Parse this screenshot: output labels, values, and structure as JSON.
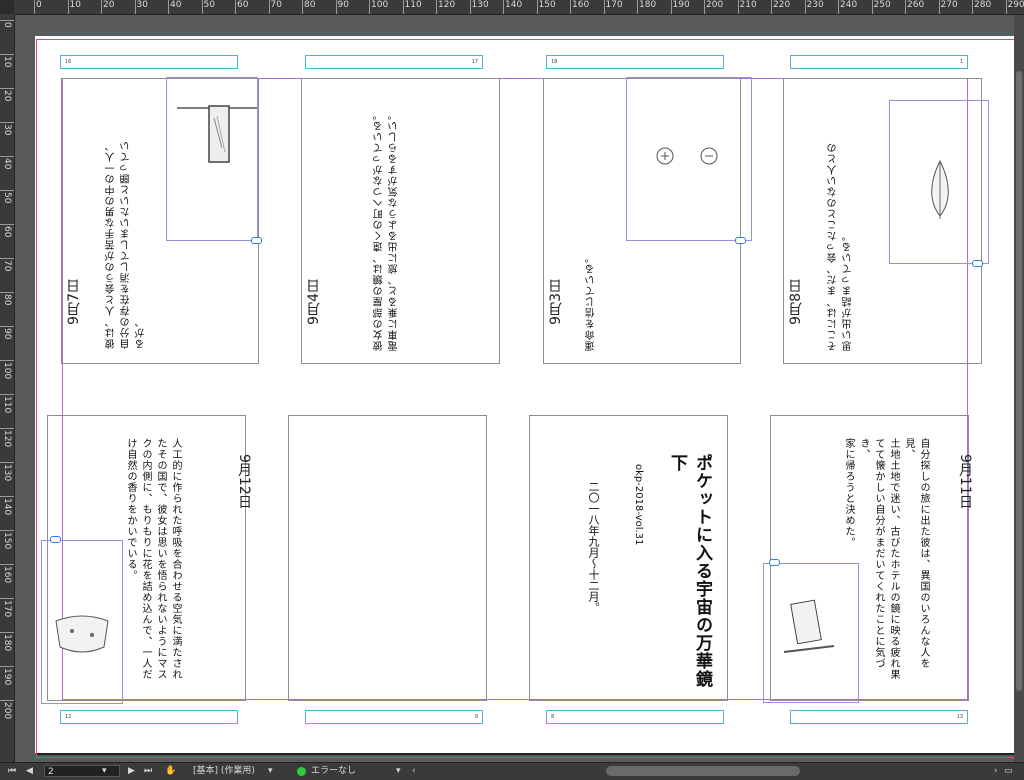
{
  "ruler": {
    "top_labels": [
      "0",
      "10",
      "20",
      "30",
      "40",
      "50",
      "60",
      "70",
      "80",
      "90",
      "100",
      "110",
      "120",
      "130",
      "140",
      "150",
      "160",
      "170",
      "180",
      "190",
      "200",
      "210",
      "220",
      "230",
      "240",
      "250",
      "260",
      "270",
      "280",
      "290"
    ],
    "left_labels": [
      "0",
      "10",
      "20",
      "30",
      "40",
      "50",
      "60",
      "70",
      "80",
      "90",
      "100",
      "110",
      "120",
      "130",
      "140",
      "150",
      "160",
      "170",
      "180",
      "190",
      "200"
    ]
  },
  "headers": {
    "top": [
      "16",
      "17",
      "18",
      "1"
    ],
    "bottom": [
      "12",
      "9",
      "8",
      "13"
    ]
  },
  "pages": {
    "p1_date": "9月7日",
    "p1_text": [
      "彼は、人と会うのが苦手な男の中の一人、",
      "自分の存在を消してしまいたいと願ってい",
      "るが、"
    ],
    "p2_date": "9月4日",
    "p2_text": [
      "彼女の部屋の鏡は、遠くの町へつながっている。",
      "電車に乗ると、旅に出るような気がするらしい。"
    ],
    "p3_date": "9月3日",
    "p3_text": [
      "運命を信じている。"
    ],
    "p4_date": "9月8日",
    "p4_text": [
      "そこには、まだ、会ったことのない人との",
      "思い出が詰まっている。"
    ],
    "p5_date": "9月12日",
    "p5_text": [
      "人工的に作られた呼吸を合わせる空気に満たされ",
      "たその国で、彼女は思いを悟られないようにマス",
      "クの内側に、もりもりに花を詰め込んで、一人だ",
      "け自然の香りをかいでいる。"
    ],
    "p6_date": "",
    "p7_title": "ポケットに入る宇宙の万華鏡 下",
    "p7_sub": "okp-2018-vol.31",
    "p7_date": "二〇一八年九月〜十二月。",
    "p8_date": "9月11日",
    "p8_text": [
      "自分探しの旅に出た彼は、異国のいろんな人を見、",
      "土地土地で迷い、古びたホテルの鏡に映る疲れ果",
      "てて懐かしい自分がまだいてくれたことに気づき、",
      "家に帰ろうと決めた。"
    ]
  },
  "status": {
    "page_value": "2",
    "master_label": "[基本] (作業用)",
    "error_label": "エラーなし"
  },
  "colors": {
    "bleed": "#e0466a",
    "margin": "#b06ad6",
    "header_frame": "#4fb4d4",
    "link": "#2f7ce0",
    "ok": "#2ecc40"
  }
}
